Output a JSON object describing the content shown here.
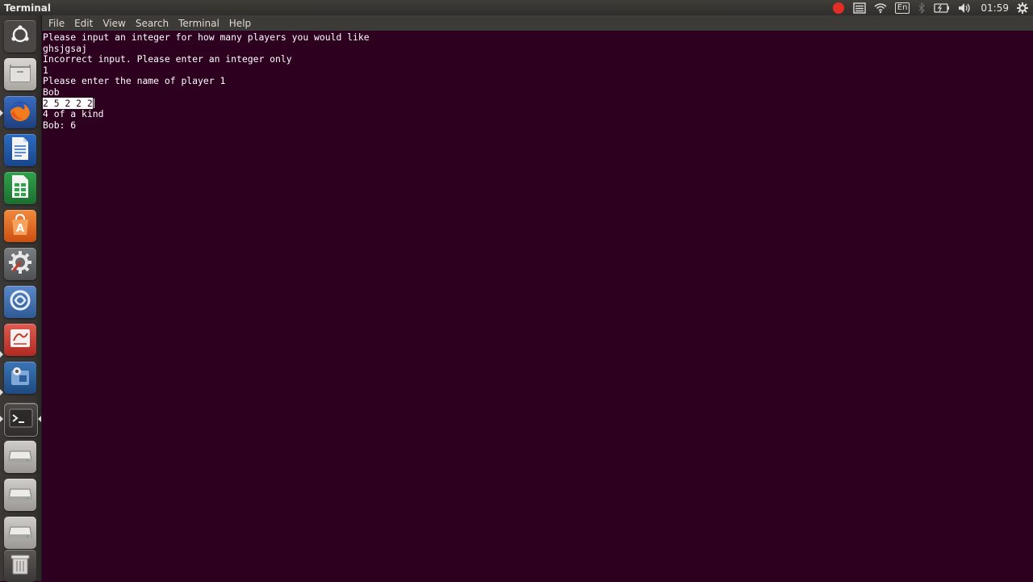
{
  "topbar": {
    "title": "Terminal",
    "clock": "01:59",
    "keyboard_layout": "En"
  },
  "launcher": {
    "items": [
      {
        "name": "dash-home-icon"
      },
      {
        "name": "files-icon"
      },
      {
        "name": "firefox-icon"
      },
      {
        "name": "writer-icon"
      },
      {
        "name": "calc-icon"
      },
      {
        "name": "software-center-icon"
      },
      {
        "name": "system-settings-icon"
      },
      {
        "name": "app-icon"
      },
      {
        "name": "text-editor-icon"
      },
      {
        "name": "media-app-icon"
      },
      {
        "name": "terminal-icon"
      },
      {
        "name": "drive-icon"
      },
      {
        "name": "drive-icon"
      },
      {
        "name": "drive-icon"
      },
      {
        "name": "trash-icon"
      }
    ]
  },
  "menubar": {
    "items": [
      "File",
      "Edit",
      "View",
      "Search",
      "Terminal",
      "Help"
    ]
  },
  "terminal": {
    "lines": [
      "Please input an integer for how many players you would like",
      "ghsjgsaj",
      "Incorrect input. Please enter an integer only",
      "1",
      "Please enter the name of player 1",
      "Bob",
      "2 5 2 2 2",
      "4 of a kind",
      "Bob: 6"
    ],
    "selected_line_index": 6
  },
  "colors": {
    "terminal_bg": "#2c001e",
    "panel_bg": "#3c3b37",
    "record_indicator": "#e52d27"
  }
}
